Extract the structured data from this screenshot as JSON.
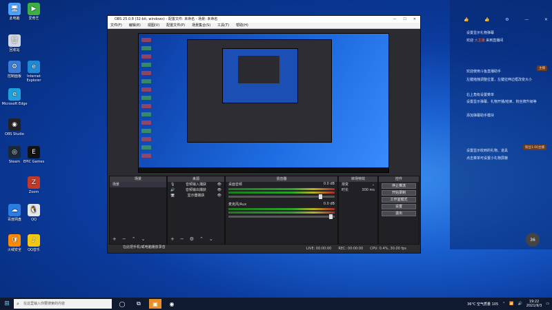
{
  "desktop": {
    "icons_left": [
      {
        "label": "此电脑",
        "color": "#4aa3ff",
        "glyph": "🖥"
      },
      {
        "label": "回收站",
        "color": "#cfd8e3",
        "glyph": "🗑"
      },
      {
        "label": "控制面板",
        "color": "#3a7bd5",
        "glyph": "⚙"
      },
      {
        "label": "Microsoft Edge",
        "color": "#1fa0d8",
        "glyph": "e"
      },
      {
        "label": "OBS Studio",
        "color": "#222",
        "glyph": "◉"
      },
      {
        "label": "Steam",
        "color": "#1b2838",
        "glyph": "◎"
      },
      {
        "label": "百度网盘",
        "color": "#2a7de1",
        "glyph": "☁"
      },
      {
        "label": "火绒安全",
        "color": "#ff8a00",
        "glyph": "🛡"
      }
    ],
    "icons_col2": [
      {
        "label": "爱奇艺",
        "color": "#3cb043",
        "glyph": "▶"
      },
      {
        "label": "Internet Explorer",
        "color": "#1e8ad6",
        "glyph": "e"
      },
      {
        "label": "EPIC Games",
        "color": "#111",
        "glyph": "E"
      },
      {
        "label": "Zoom",
        "color": "#c0392b",
        "glyph": "Z"
      },
      {
        "label": "QQ",
        "color": "#e6e6e6",
        "glyph": "🐧"
      },
      {
        "label": "QQ音乐",
        "color": "#f2c811",
        "glyph": "♪"
      }
    ]
  },
  "obs": {
    "title": "OBS 25.0.8 (32-bit, windows) - 配置文件: 未命名 - 场景: 未命名",
    "menu": [
      "文件(F)",
      "编辑(E)",
      "视图(V)",
      "配置文件(P)",
      "场景集合(S)",
      "工具(T)",
      "帮助(H)"
    ],
    "panels": {
      "scenes": {
        "title": "场景",
        "items": [
          "场景"
        ]
      },
      "sources": {
        "title": "来源",
        "items": [
          "音频输入捕获",
          "音频输出捕获",
          "显示器捕获"
        ]
      },
      "mixer": {
        "title": "混音器",
        "tracks": [
          {
            "name": "桌面音频",
            "db": "0.0 dB"
          },
          {
            "name": "麦克风/Aux",
            "db": "0.0 dB"
          }
        ]
      },
      "transitions": {
        "title": "转场特效",
        "type": "渐变",
        "duration_label": "时长",
        "duration": "300 ms"
      },
      "controls": {
        "title": "控件",
        "buttons": [
          "停止推流",
          "开始录制",
          "工作室模式",
          "设置",
          "退出"
        ]
      }
    },
    "status": {
      "live": "LIVE: 00:00:00",
      "rec": "REC: 00:00:00",
      "cpu": "CPU: 0.4%, 30.00 fps"
    }
  },
  "chat": {
    "messages": [
      {
        "text": "欢迎使用斗鱼直播助手",
        "highlight": ""
      },
      {
        "text": "左键拖拽调整位置，左键拉伸边框改变大小",
        "highlight": ""
      },
      {
        "text": "右上角有设置菜单",
        "highlight": ""
      },
      {
        "text": "设置显示弹幕、礼物开播/结束、粉丝牌升级等",
        "highlight": ""
      },
      {
        "text": "添加弹幕助手模块",
        "highlight": ""
      }
    ],
    "top_msgs": [
      "设置显示礼物弹幕",
      "欢迎",
      "来到直播间"
    ],
    "highlight_name": "大主播",
    "footer_msgs": [
      "设置显示收到的礼物、道具",
      "点击菜单可设置小礼物屏蔽"
    ],
    "room_count": "36",
    "tags": [
      "主播",
      "粉丝1.00主播"
    ]
  },
  "notify": "在此把手机/或电脑播放录音",
  "taskbar": {
    "search_placeholder": "在这里输入你要搜索的内容",
    "temp": "36°C 空气质量 105",
    "time": "19:22",
    "date": "2021/9/3"
  }
}
